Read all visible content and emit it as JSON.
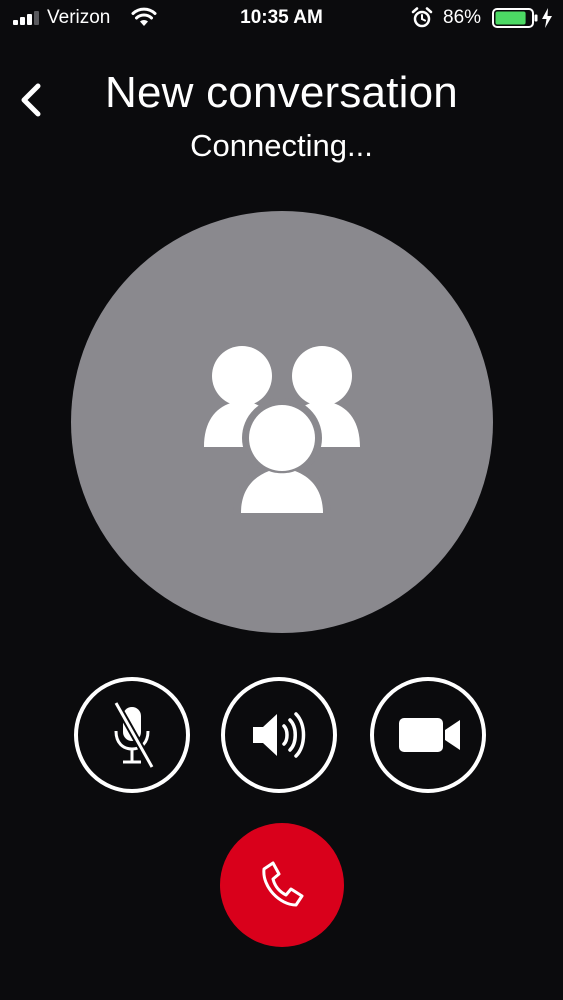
{
  "status_bar": {
    "carrier": "Verizon",
    "time": "10:35 AM",
    "battery_percent": "86%",
    "signal_bars": 3,
    "battery_level": 0.86,
    "battery_color": "#4cd964"
  },
  "header": {
    "title": "New conversation",
    "status": "Connecting..."
  },
  "avatar": {
    "icon": "group-icon",
    "background_color": "#8a898e"
  },
  "controls": {
    "mute": {
      "icon": "microphone-muted-icon",
      "state": "muted"
    },
    "speaker": {
      "icon": "speaker-icon"
    },
    "video": {
      "icon": "video-camera-icon"
    },
    "end_call": {
      "icon": "phone-hangup-icon",
      "color": "#d9001b"
    }
  }
}
